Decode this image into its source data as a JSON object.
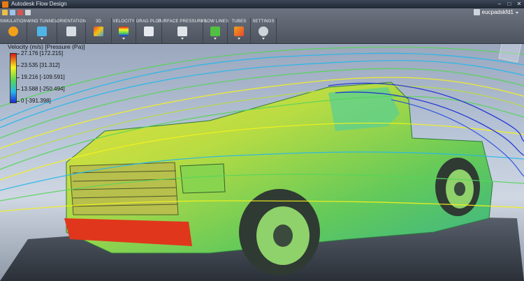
{
  "window": {
    "title": "Autodesk Flow Design",
    "controls": {
      "minimize": "–",
      "maximize": "□",
      "close": "✕"
    }
  },
  "user": {
    "name": "eucpadskfd1"
  },
  "ribbon": {
    "panels": [
      {
        "label": "SIMULATION",
        "icon": "simulation-icon",
        "color": "#f0a11a"
      },
      {
        "label": "WIND TUNNEL",
        "icon": "wind-tunnel-icon",
        "color": "#4fb5e6"
      },
      {
        "label": "ORIENTATION",
        "icon": "orientation-icon",
        "color": "#d8dde4"
      },
      {
        "label": "3D",
        "icon": "3d-icon",
        "color": "#e9472b"
      },
      {
        "label": "VELOCITY",
        "icon": "velocity-icon",
        "color": "#3b86d9"
      },
      {
        "label": "DRAG PLOT",
        "icon": "drag-plot-icon",
        "color": "#e6e9ee"
      },
      {
        "label": "SURFACE PRESSURES",
        "icon": "surface-pressures-icon",
        "color": "#e0e3e8"
      },
      {
        "label": "FLOW LINES",
        "icon": "flow-lines-icon",
        "color": "#52c043"
      },
      {
        "label": "TUBES",
        "icon": "tubes-icon",
        "color": "#f0a11a"
      },
      {
        "label": "SETTINGS",
        "icon": "settings-icon",
        "color": "#cfd4db"
      }
    ]
  },
  "legend": {
    "title": "Velocity (m/s) [Pressure (Pa)]",
    "labels": [
      "27.176 [172.215]",
      "23.535 [31.312]",
      "19.216 [-109.591]",
      "13.588 [-250.494]",
      "0 [-391.398]"
    ],
    "colors": {
      "high": "#d71a17",
      "mid_high": "#f5f21d",
      "mid": "#58d45a",
      "mid_low": "#27b7ea",
      "low": "#1b2bd6"
    }
  }
}
